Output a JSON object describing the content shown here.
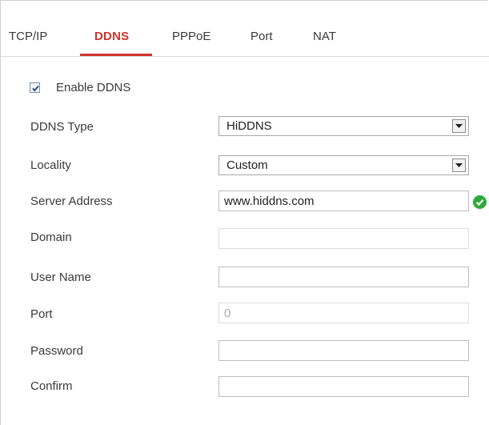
{
  "tabs": [
    {
      "label": "TCP/IP",
      "active": false
    },
    {
      "label": "DDNS",
      "active": true
    },
    {
      "label": "PPPoE",
      "active": false
    },
    {
      "label": "Port",
      "active": false
    },
    {
      "label": "NAT",
      "active": false
    }
  ],
  "enable_ddns": {
    "label": "Enable DDNS",
    "checked": true
  },
  "form": {
    "ddns_type": {
      "label": "DDNS Type",
      "value": "HiDDNS"
    },
    "locality": {
      "label": "Locality",
      "value": "Custom"
    },
    "server_address": {
      "label": "Server Address",
      "value": "www.hiddns.com",
      "status_icon": "check-circle-icon"
    },
    "domain": {
      "label": "Domain",
      "value": ""
    },
    "user_name": {
      "label": "User Name",
      "value": ""
    },
    "port": {
      "label": "Port",
      "value": "0"
    },
    "password": {
      "label": "Password",
      "value": ""
    },
    "confirm": {
      "label": "Confirm",
      "value": ""
    }
  },
  "colors": {
    "accent": "#d2322d",
    "ok": "#2eaa3c"
  }
}
